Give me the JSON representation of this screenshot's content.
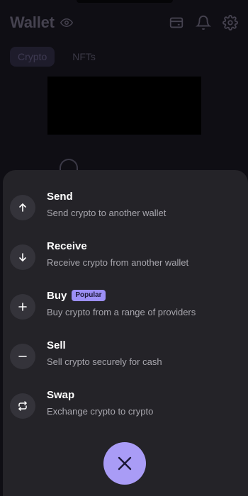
{
  "background": {
    "title": "Wallet",
    "tabs": [
      {
        "label": "Crypto",
        "active": true
      },
      {
        "label": "NFTs",
        "active": false
      }
    ],
    "icons": [
      "eye-icon",
      "card-icon",
      "bell-icon",
      "gear-icon"
    ]
  },
  "sheet": {
    "actions": [
      {
        "title": "Send",
        "subtitle": "Send crypto to another wallet",
        "icon": "arrow-up-icon"
      },
      {
        "title": "Receive",
        "subtitle": "Receive crypto from another wallet",
        "icon": "arrow-down-icon"
      },
      {
        "title": "Buy",
        "subtitle": "Buy crypto from a range of providers",
        "icon": "plus-icon",
        "badge": "Popular"
      },
      {
        "title": "Sell",
        "subtitle": "Sell crypto securely for cash",
        "icon": "minus-icon"
      },
      {
        "title": "Swap",
        "subtitle": "Exchange crypto to crypto",
        "icon": "swap-icon"
      }
    ]
  },
  "close_button": {
    "icon": "close-icon"
  },
  "colors": {
    "accent": "#a99cf6",
    "badge": "#9c8ff5",
    "sheet_bg": "#242328",
    "icon_circle": "#34333a"
  }
}
